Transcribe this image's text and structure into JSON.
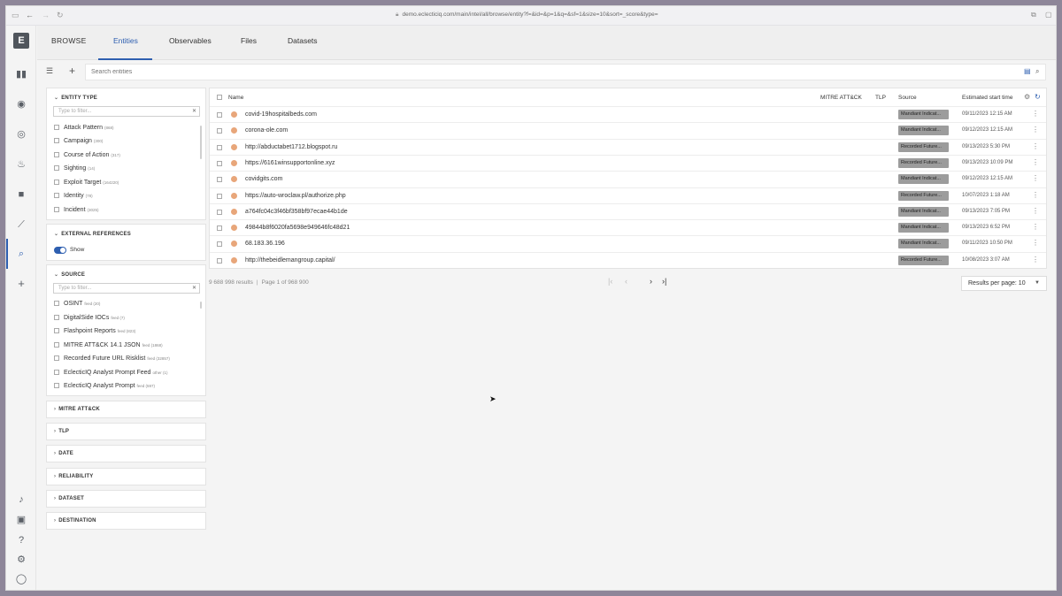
{
  "browser": {
    "url": "demo.eclecticiq.com/main/intel/all/browse/entity?f=&id=&p=1&q=&sf=1&size=10&sort=_score&type="
  },
  "app": {
    "logo": "E"
  },
  "nav": {
    "browse": "BROWSE",
    "tabs": [
      "Entities",
      "Observables",
      "Files",
      "Datasets"
    ]
  },
  "search": {
    "placeholder": "Search entities"
  },
  "entity_type": {
    "title": "ENTITY TYPE",
    "filter_placeholder": "Type to filter...",
    "items": [
      {
        "label": "Attack Pattern",
        "count": "(868)"
      },
      {
        "label": "Campaign",
        "count": "(300)"
      },
      {
        "label": "Course of Action",
        "count": "(317)"
      },
      {
        "label": "Sighting",
        "count": "(14)"
      },
      {
        "label": "Exploit Target",
        "count": "(164220)"
      },
      {
        "label": "Identity",
        "count": "(78)"
      },
      {
        "label": "Incident",
        "count": "(3025)"
      }
    ]
  },
  "external_references": {
    "title": "EXTERNAL REFERENCES",
    "toggle_label": "Show"
  },
  "source": {
    "title": "SOURCE",
    "filter_placeholder": "Type to filter...",
    "items": [
      {
        "label": "OSINT",
        "count": "feed (20)"
      },
      {
        "label": "DigitalSide IOCs",
        "count": "feed (7)"
      },
      {
        "label": "Flashpoint Reports",
        "count": "feed (823)"
      },
      {
        "label": "MITRE ATT&CK 14.1 JSON",
        "count": "feed (1868)"
      },
      {
        "label": "Recorded Future URL Risklist",
        "count": "feed (32857)"
      },
      {
        "label": "EclecticIQ Analyst Prompt Feed",
        "count": "other (1)"
      },
      {
        "label": "EclecticIQ Analyst Prompt",
        "count": "feed (597)"
      }
    ]
  },
  "collapsed_panels": [
    "MITRE ATT&CK",
    "TLP",
    "DATE",
    "RELIABILITY",
    "DATASET",
    "DESTINATION"
  ],
  "table": {
    "columns": [
      "Name",
      "MITRE ATT&CK",
      "TLP",
      "Source",
      "Estimated start time"
    ],
    "rows": [
      {
        "name": "covid-19hospitalbeds.com",
        "source": "Mandiant Indicat...",
        "date": "09/11/2023 12:15 AM"
      },
      {
        "name": "corona-ole.com",
        "source": "Mandiant Indicat...",
        "date": "09/12/2023 12:15 AM"
      },
      {
        "name": "http://abductabet1712.blogspot.ru",
        "source": "Recorded Future...",
        "date": "09/13/2023 5:30 PM"
      },
      {
        "name": "https://6161winsupportonline.xyz",
        "source": "Recorded Future...",
        "date": "09/13/2023 10:09 PM"
      },
      {
        "name": "covidgits.com",
        "source": "Mandiant Indicat...",
        "date": "09/12/2023 12:15 AM"
      },
      {
        "name": "https://auto-wroclaw.pl/authorize.php",
        "source": "Recorded Future...",
        "date": "10/07/2023 1:18 AM"
      },
      {
        "name": "a764fc04c3f46bf358bf97ecae44b1de",
        "source": "Mandiant Indicat...",
        "date": "09/13/2023 7:05 PM"
      },
      {
        "name": "49844b8f6020fa5698e949646fc48d21",
        "source": "Mandiant Indicat...",
        "date": "09/13/2023 6:52 PM"
      },
      {
        "name": "68.183.36.196",
        "source": "Mandiant Indicat...",
        "date": "09/11/2023 10:50 PM"
      },
      {
        "name": "http://thebeidlemangroup.capital/",
        "source": "Recorded Future...",
        "date": "10/08/2023 3:07 AM"
      }
    ]
  },
  "footer": {
    "results": "9 688 998 results",
    "page": "Page 1 of 968 900",
    "results_per_page": "Results per page: 10"
  }
}
